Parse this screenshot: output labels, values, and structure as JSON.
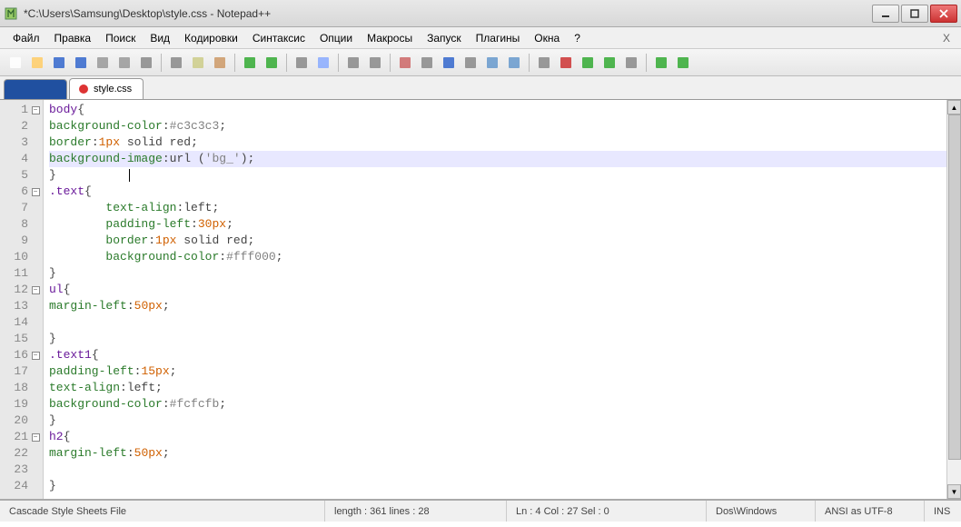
{
  "title": "*C:\\Users\\Samsung\\Desktop\\style.css - Notepad++",
  "menu": [
    "Файл",
    "Правка",
    "Поиск",
    "Вид",
    "Кодировки",
    "Синтаксис",
    "Опции",
    "Макросы",
    "Запуск",
    "Плагины",
    "Окна",
    "?"
  ],
  "tabs": [
    {
      "label": "",
      "blank": true
    },
    {
      "label": "style.css",
      "active": true
    }
  ],
  "lines": [
    {
      "n": 1,
      "fold": true,
      "html": "<span class='kw'>body</span><span class='punct'>{</span>"
    },
    {
      "n": 2,
      "html": "<span class='prop'>background-color</span><span class='punct'>:</span><span class='col'>#c3c3c3</span><span class='punct'>;</span>"
    },
    {
      "n": 3,
      "html": "<span class='prop'>border</span><span class='punct'>:</span><span class='num'>1px</span> <span class='val'>solid</span> <span class='val'>red</span><span class='punct'>;</span>"
    },
    {
      "n": 4,
      "hl": true,
      "html": "<span class='prop'>background-image</span><span class='punct'>:</span><span class='val'>url</span> <span class='punct'>(</span><span class='str'>'bg_'</span><span class='punct'>)</span><span class='punct'>;</span>"
    },
    {
      "n": 5,
      "cursor": true,
      "html": "<span class='punct'>}</span>"
    },
    {
      "n": 6,
      "fold": true,
      "html": "<span class='kw'>.text</span><span class='punct'>{</span>"
    },
    {
      "n": 7,
      "html": "        <span class='prop'>text-align</span><span class='punct'>:</span><span class='val'>left</span><span class='punct'>;</span>"
    },
    {
      "n": 8,
      "html": "        <span class='prop'>padding-left</span><span class='punct'>:</span><span class='num'>30px</span><span class='punct'>;</span>"
    },
    {
      "n": 9,
      "html": "        <span class='prop'>border</span><span class='punct'>:</span><span class='num'>1px</span> <span class='val'>solid</span> <span class='val'>red</span><span class='punct'>;</span>"
    },
    {
      "n": 10,
      "html": "        <span class='prop'>background-color</span><span class='punct'>:</span><span class='col'>#fff000</span><span class='punct'>;</span>"
    },
    {
      "n": 11,
      "html": "<span class='punct'>}</span>"
    },
    {
      "n": 12,
      "fold": true,
      "html": "<span class='kw'>ul</span><span class='punct'>{</span>"
    },
    {
      "n": 13,
      "html": "<span class='prop'>margin-left</span><span class='punct'>:</span><span class='num'>50px</span><span class='punct'>;</span>"
    },
    {
      "n": 14,
      "html": ""
    },
    {
      "n": 15,
      "html": "<span class='punct'>}</span>"
    },
    {
      "n": 16,
      "fold": true,
      "html": "<span class='kw'>.text1</span><span class='punct'>{</span>"
    },
    {
      "n": 17,
      "html": "<span class='prop'>padding-left</span><span class='punct'>:</span><span class='num'>15px</span><span class='punct'>;</span>"
    },
    {
      "n": 18,
      "html": "<span class='prop'>text-align</span><span class='punct'>:</span><span class='val'>left</span><span class='punct'>;</span>"
    },
    {
      "n": 19,
      "html": "<span class='prop'>background-color</span><span class='punct'>:</span><span class='col'>#fcfcfb</span><span class='punct'>;</span>"
    },
    {
      "n": 20,
      "html": "<span class='punct'>}</span>"
    },
    {
      "n": 21,
      "fold": true,
      "html": "<span class='kw'>h2</span><span class='punct'>{</span>"
    },
    {
      "n": 22,
      "html": "<span class='prop'>margin-left</span><span class='punct'>:</span><span class='num'>50px</span><span class='punct'>;</span>"
    },
    {
      "n": 23,
      "html": ""
    },
    {
      "n": 24,
      "html": "<span class='punct'>}</span>"
    }
  ],
  "status": {
    "filetype": "Cascade Style Sheets File",
    "length": "length : 361    lines : 28",
    "pos": "Ln : 4    Col : 27    Sel : 0",
    "eol": "Dos\\Windows",
    "enc": "ANSI as UTF-8",
    "ins": "INS"
  },
  "toolbar_icons": [
    "new",
    "open",
    "save",
    "save-all",
    "close",
    "close-all",
    "print",
    "",
    "cut",
    "copy",
    "paste",
    "",
    "undo",
    "redo",
    "",
    "find",
    "replace",
    "",
    "zoom-in",
    "zoom-out",
    "",
    "sync",
    "wrap",
    "all-chars",
    "indent",
    "fold",
    "unfold",
    "",
    "hide",
    "rec",
    "play",
    "play-multi",
    "record",
    "",
    "spellcheck",
    "spell-next"
  ]
}
